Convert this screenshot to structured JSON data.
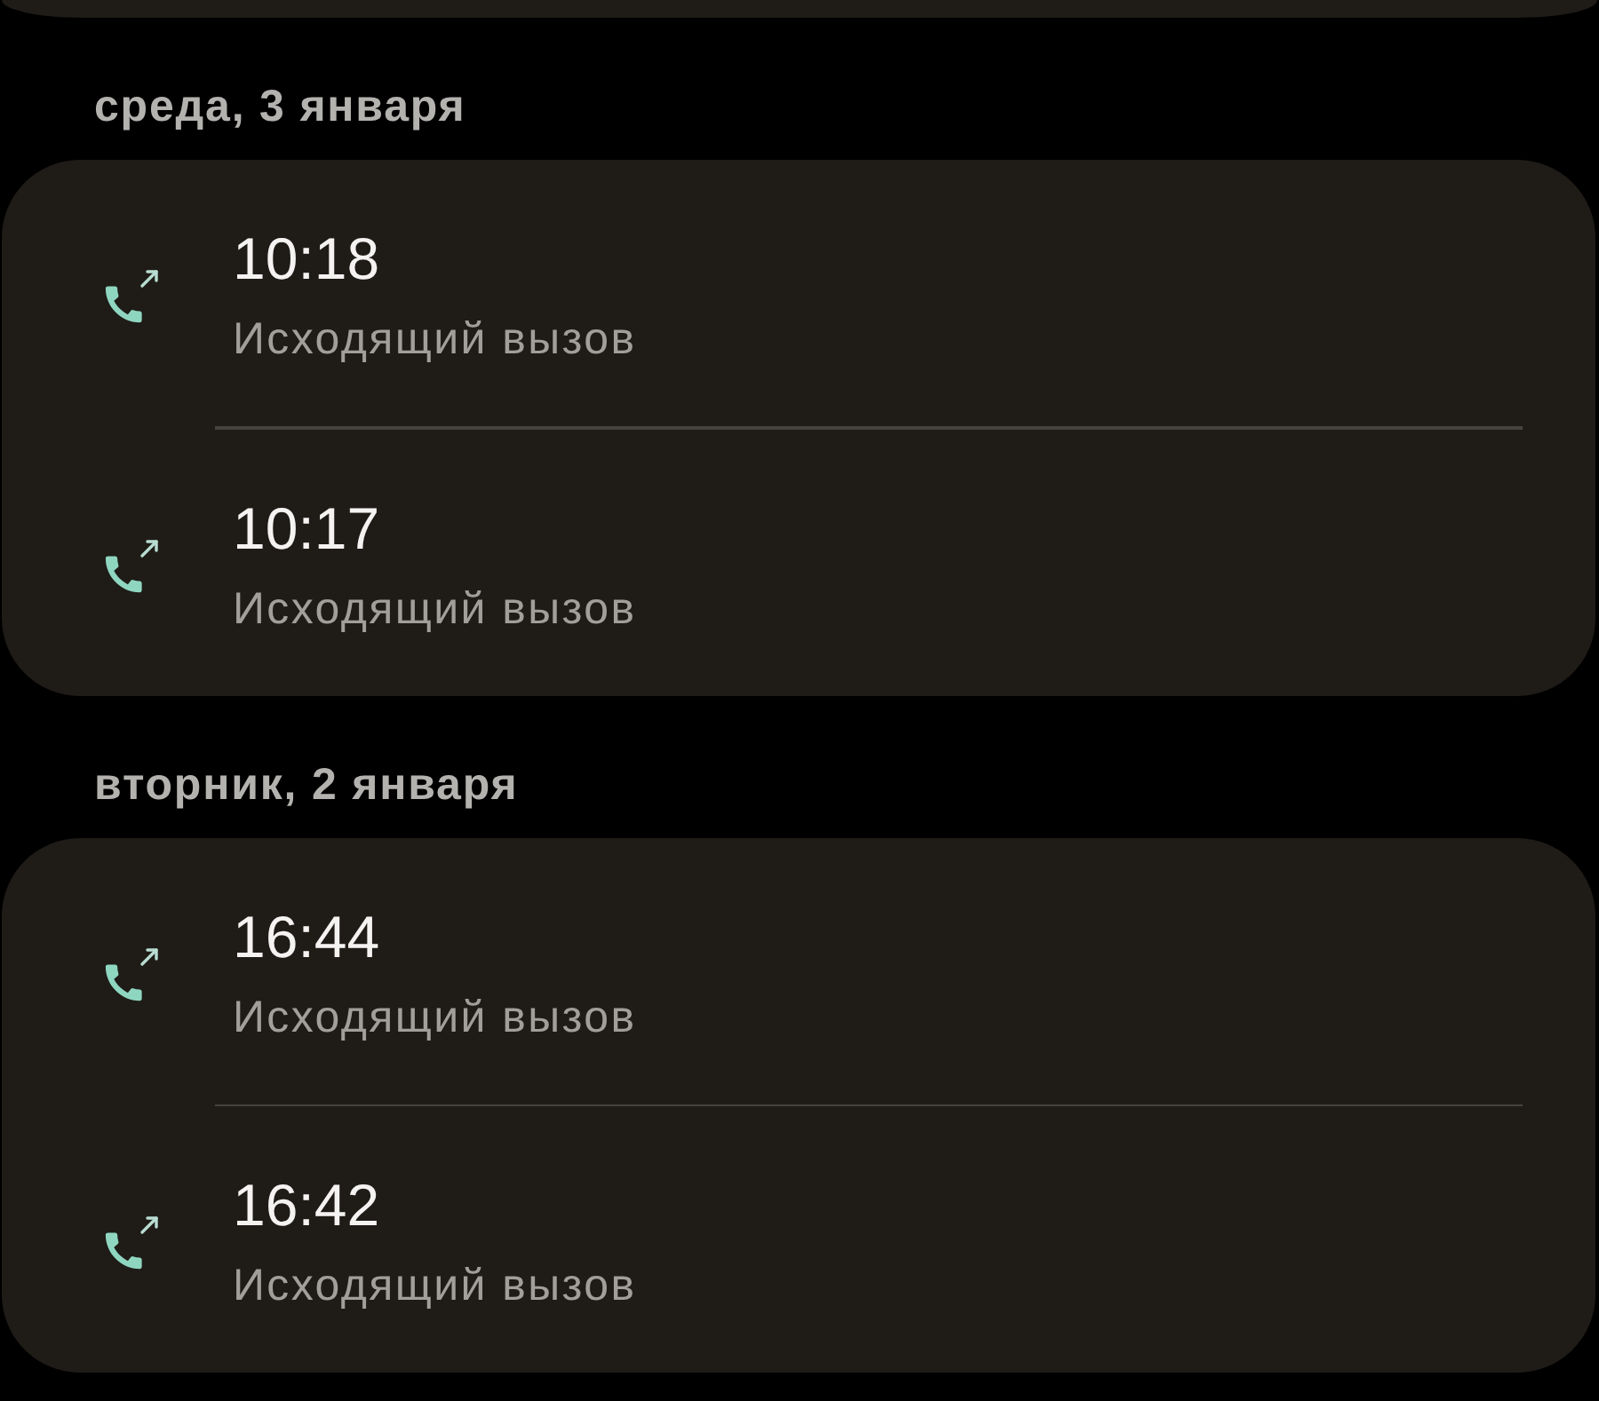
{
  "sections": [
    {
      "date": "среда, 3 января",
      "calls": [
        {
          "kind": "outgoing",
          "time": "10:18",
          "type": "Исходящий вызов"
        },
        {
          "kind": "outgoing",
          "time": "10:17",
          "type": "Исходящий вызов"
        }
      ]
    },
    {
      "date": "вторник, 2 января",
      "calls": [
        {
          "kind": "outgoing",
          "time": "16:44",
          "type": "Исходящий вызов"
        },
        {
          "kind": "outgoing",
          "time": "16:42",
          "type": "Исходящий вызов"
        }
      ]
    }
  ]
}
